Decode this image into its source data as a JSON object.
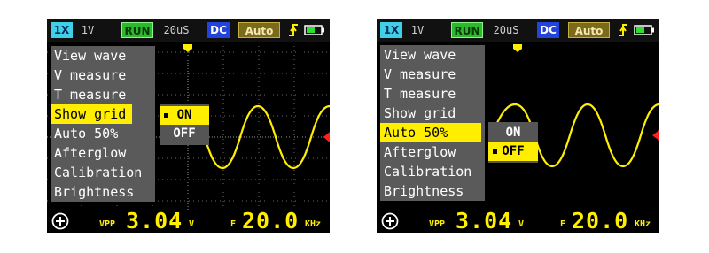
{
  "screens": [
    {
      "id": "left",
      "status": {
        "probe": "1X",
        "volts_div": "1V",
        "run": "RUN",
        "time_div": "20uS",
        "coupling": "DC",
        "trigger_mode": "Auto"
      },
      "menu": [
        "View wave",
        "V measure",
        "T measure",
        "Show grid",
        "Auto 50%",
        "Afterglow",
        "Calibration",
        "Brightness"
      ],
      "selected_menu_index": 3,
      "submenu": {
        "options": [
          "ON",
          "OFF"
        ],
        "selected": "ON"
      },
      "show_grid": true,
      "readout": {
        "vpp_label": "VPP",
        "vpp_value": "3.04",
        "vpp_unit": "V",
        "f_label": "F",
        "f_value": "20.0",
        "f_unit": "KHz"
      }
    },
    {
      "id": "right",
      "status": {
        "probe": "1X",
        "volts_div": "1V",
        "run": "RUN",
        "time_div": "20uS",
        "coupling": "DC",
        "trigger_mode": "Auto"
      },
      "menu": [
        "View wave",
        "V measure",
        "T measure",
        "Show grid",
        "Auto 50%",
        "Afterglow",
        "Calibration",
        "Brightness"
      ],
      "selected_menu_index": 4,
      "submenu": {
        "options": [
          "ON",
          "OFF"
        ],
        "selected": "OFF"
      },
      "show_grid": false,
      "readout": {
        "vpp_label": "VPP",
        "vpp_value": "3.04",
        "vpp_unit": "V",
        "f_label": "F",
        "f_value": "20.0",
        "f_unit": "KHz"
      }
    }
  ],
  "colors": {
    "trace": "#ffee00",
    "accent": "#ffee00",
    "trigger_marker": "#ff2020",
    "run_green": "#2eb82e",
    "dc_blue": "#2244dd",
    "probe_cyan": "#3fd0e8"
  },
  "icons": {
    "trigger_edge": "rising-edge-icon",
    "battery": "battery-icon",
    "menu": "plus-circle-icon"
  }
}
